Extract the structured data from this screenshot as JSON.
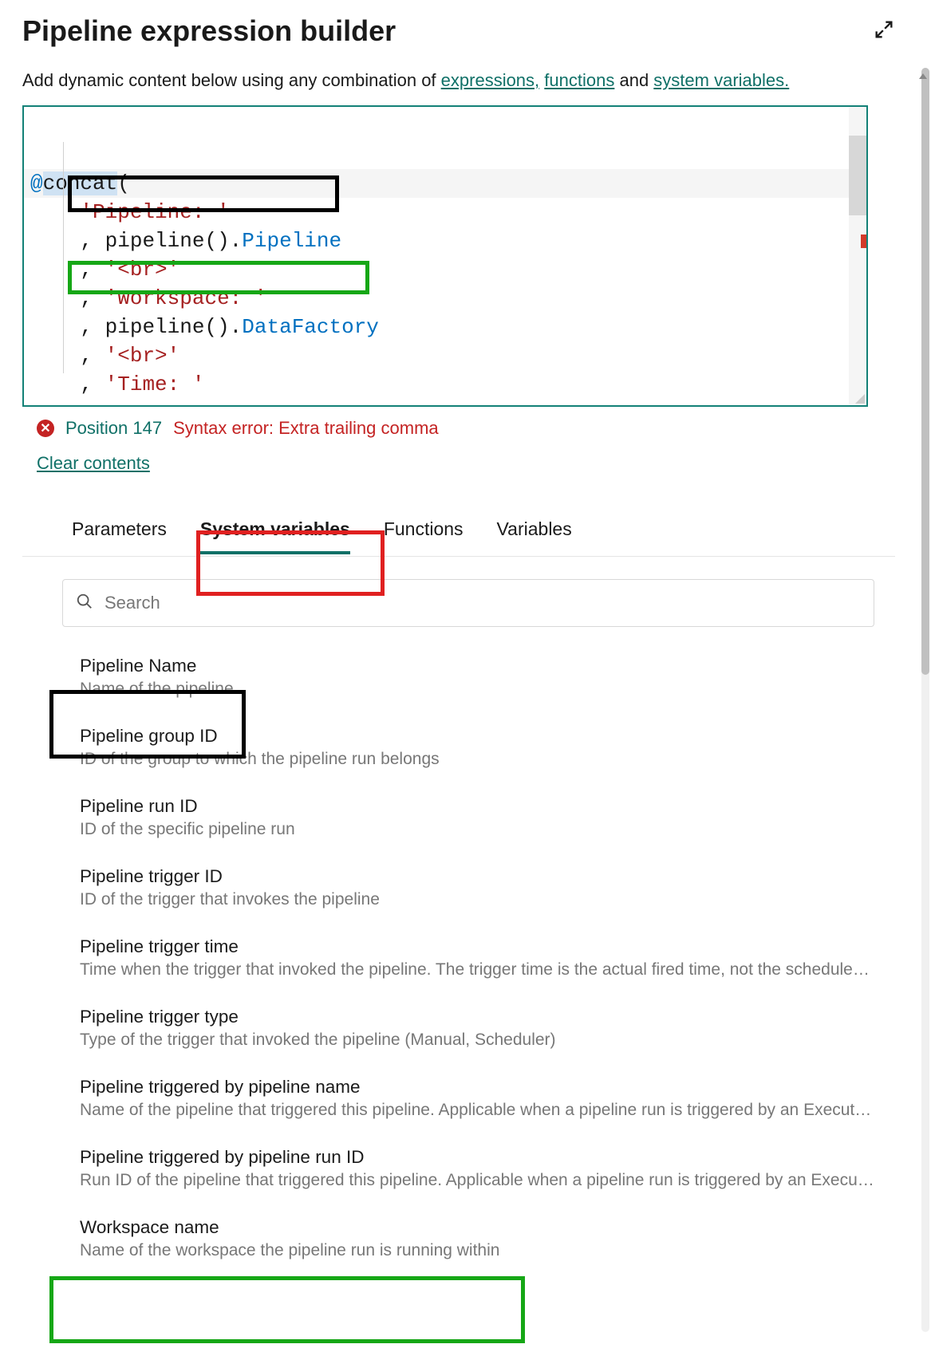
{
  "header": {
    "title": "Pipeline expression builder"
  },
  "intro": {
    "text_pre": "Add dynamic content below using any combination of ",
    "link_expressions": "expressions,",
    "link_functions": "functions",
    "text_and": " and ",
    "link_system_vars": "system variables.",
    "text_post": ""
  },
  "editor": {
    "at": "@",
    "fn": "concat",
    "open": "(",
    "line1_str": "'Pipeline: '",
    "line2_comma": ",",
    "line2_call": "pipeline()",
    "line2_dot": ".",
    "line2_prop": "Pipeline",
    "line3_comma": ",",
    "line3_str": "'<br>'",
    "line4_comma": ",",
    "line4_str": "'Workspace: '",
    "line5_comma": ",",
    "line5_call": "pipeline()",
    "line5_dot": ".",
    "line5_prop": "DataFactory",
    "line6_comma": ",",
    "line6_str": "'<br>'",
    "line7_comma": ",",
    "line7_str": "'Time: '",
    "line8_comma": ",",
    "close": ")"
  },
  "error": {
    "position": "Position 147",
    "message": "Syntax error: Extra trailing comma"
  },
  "clear": "Clear contents",
  "tabs": {
    "parameters": "Parameters",
    "system_variables": "System variables",
    "functions": "Functions",
    "variables": "Variables"
  },
  "search": {
    "placeholder": "Search"
  },
  "items": [
    {
      "title": "Pipeline Name",
      "desc": "Name of the pipeline"
    },
    {
      "title": "Pipeline group ID",
      "desc": "ID of the group to which the pipeline run belongs"
    },
    {
      "title": "Pipeline run ID",
      "desc": "ID of the specific pipeline run"
    },
    {
      "title": "Pipeline trigger ID",
      "desc": "ID of the trigger that invokes the pipeline"
    },
    {
      "title": "Pipeline trigger time",
      "desc": "Time when the trigger that invoked the pipeline. The trigger time is the actual fired time, not the scheduled time."
    },
    {
      "title": "Pipeline trigger type",
      "desc": "Type of the trigger that invoked the pipeline (Manual, Scheduler)"
    },
    {
      "title": "Pipeline triggered by pipeline name",
      "desc": "Name of the pipeline that triggered this pipeline. Applicable when a pipeline run is triggered by an Execute Pipeline activity."
    },
    {
      "title": "Pipeline triggered by pipeline run ID",
      "desc": "Run ID of the pipeline that triggered this pipeline. Applicable when a pipeline run is triggered by an Execute Pipeline activity."
    },
    {
      "title": "Workspace name",
      "desc": "Name of the workspace the pipeline run is running within"
    }
  ]
}
